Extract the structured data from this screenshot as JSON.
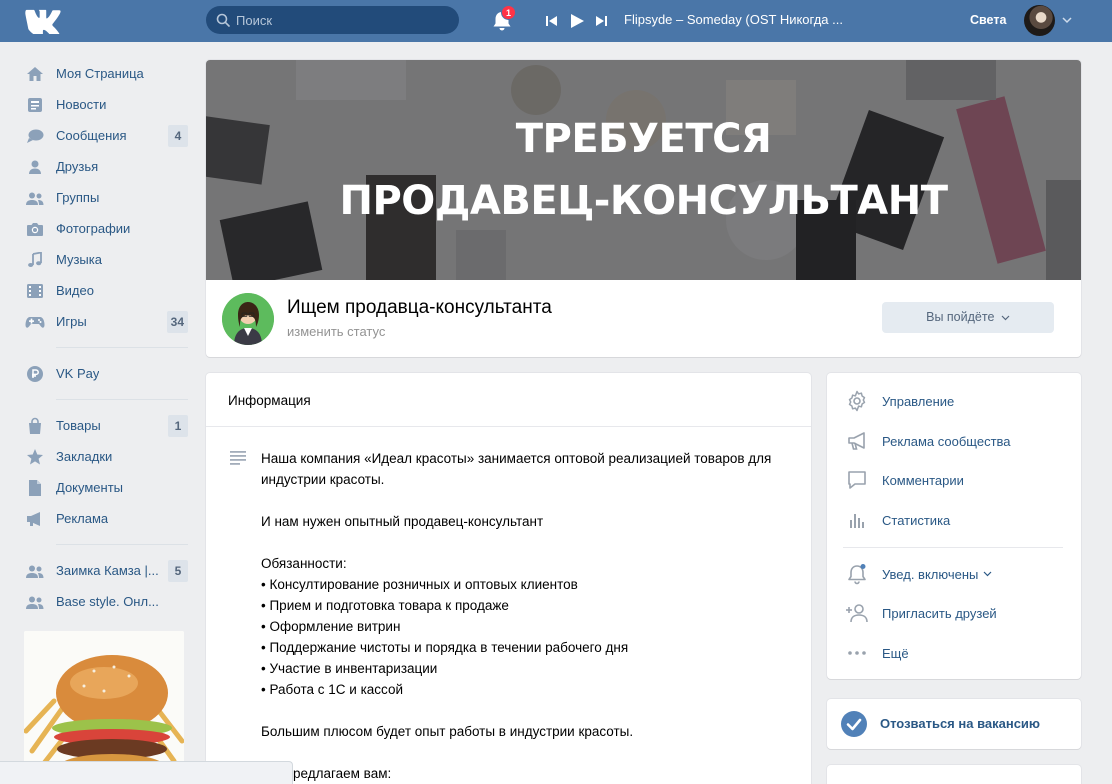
{
  "header": {
    "search_placeholder": "Поиск",
    "notifications_count": "1",
    "track": "Flipsyde – Someday (OST Никогда ...",
    "user_name": "Света"
  },
  "sidebar": {
    "items": [
      {
        "label": "Моя Страница",
        "icon": "home-icon"
      },
      {
        "label": "Новости",
        "icon": "news-icon"
      },
      {
        "label": "Сообщения",
        "icon": "messages-icon",
        "count": "4"
      },
      {
        "label": "Друзья",
        "icon": "friends-icon"
      },
      {
        "label": "Группы",
        "icon": "groups-icon"
      },
      {
        "label": "Фотографии",
        "icon": "camera-icon"
      },
      {
        "label": "Музыка",
        "icon": "music-icon"
      },
      {
        "label": "Видео",
        "icon": "video-icon"
      },
      {
        "label": "Игры",
        "icon": "games-icon",
        "count": "34"
      }
    ],
    "pay": {
      "label": "VK Pay",
      "icon": "vkpay-icon"
    },
    "items2": [
      {
        "label": "Товары",
        "icon": "goods-icon",
        "count": "1"
      },
      {
        "label": "Закладки",
        "icon": "star-icon"
      },
      {
        "label": "Документы",
        "icon": "document-icon"
      },
      {
        "label": "Реклама",
        "icon": "ads-icon"
      }
    ],
    "communities": [
      {
        "label": "Заимка Камза |...",
        "count": "5"
      },
      {
        "label": "Base style. Онл..."
      }
    ]
  },
  "cover": {
    "line1": "ТРЕБУЕТСЯ",
    "line2": "ПРОДАВЕЦ-КОНСУЛЬТАНТ"
  },
  "group": {
    "name": "Ищем продавца-консультанта",
    "status": "изменить статус",
    "join_label": "Вы пойдёте"
  },
  "info": {
    "title": "Информация",
    "text": "Наша компания «Идеал красоты» занимается оптовой реализацией товаров для индустрии красоты.\n\nИ нам нужен опытный продавец-консультант\n\nОбязанности:\n• Консултирование розничных и оптовых клиентов\n• Прием и подготовка товара к продаже\n• Оформление витрин\n• Поддержание чистоты и порядка в течении рабочего дня\n• Участие в инвентаризации\n• Работа с 1С и кассой\n\nБольшим плюсом будет опыт работы в индустрии красоты.\n\nМы предлагаем вам:"
  },
  "actions": {
    "manage": "Управление",
    "ads": "Реклама сообщества",
    "comments": "Комментарии",
    "stats": "Статистика",
    "notifications": "Увед. включены",
    "invite": "Пригласить друзей",
    "more": "Ещё"
  },
  "respond": {
    "label": "Отозваться на вакансию"
  },
  "colors": {
    "header": "#4a76a8",
    "link": "#2a5885",
    "accent": "#5181b8"
  }
}
